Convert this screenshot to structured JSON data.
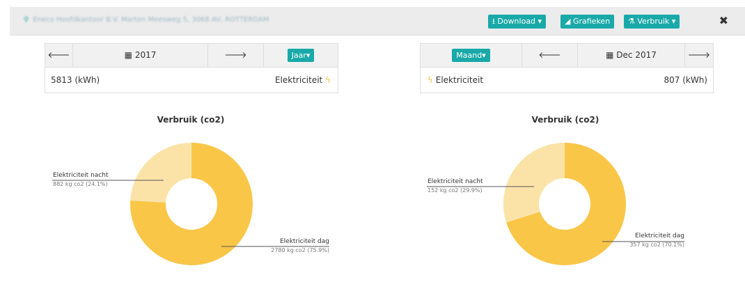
{
  "header": {
    "location": "Eneco Hoofdkantoor B.V. Marten Meesweg 5, 3068 AV, ROTTERDAM",
    "download_label": "Download",
    "charts_label": "Grafieken",
    "usage_label": "Verbruik",
    "close_glyph": "✖"
  },
  "left": {
    "prev_glyph": "🡐",
    "next_glyph": "🡒",
    "period": "2017",
    "period_type": "Jaar",
    "total": "5813 (kWh)",
    "energy": "Elektriciteit"
  },
  "right": {
    "prev_glyph": "🡐",
    "next_glyph": "🡒",
    "period": "Dec 2017",
    "period_type": "Maand",
    "total": "807 (kWh)",
    "energy": "Elektriciteit"
  },
  "colors": {
    "accent": "#19a9a8",
    "day": "#f9c647",
    "night": "#fbe3a8"
  },
  "chart_data": [
    {
      "type": "pie",
      "title": "Verbruik (co2)",
      "slices": [
        {
          "name": "Elektriciteit nacht",
          "value": 882,
          "label": "882 kg co2 (24.1%)"
        },
        {
          "name": "Elektriciteit dag",
          "value": 2780,
          "label": "2780 kg co2 (75.9%)"
        }
      ]
    },
    {
      "type": "pie",
      "title": "Verbruik (co2)",
      "slices": [
        {
          "name": "Elektriciteit nacht",
          "value": 152,
          "label": "152 kg co2 (29.9%)"
        },
        {
          "name": "Elektriciteit dag",
          "value": 357,
          "label": "357 kg co2 (70.1%)"
        }
      ]
    }
  ]
}
